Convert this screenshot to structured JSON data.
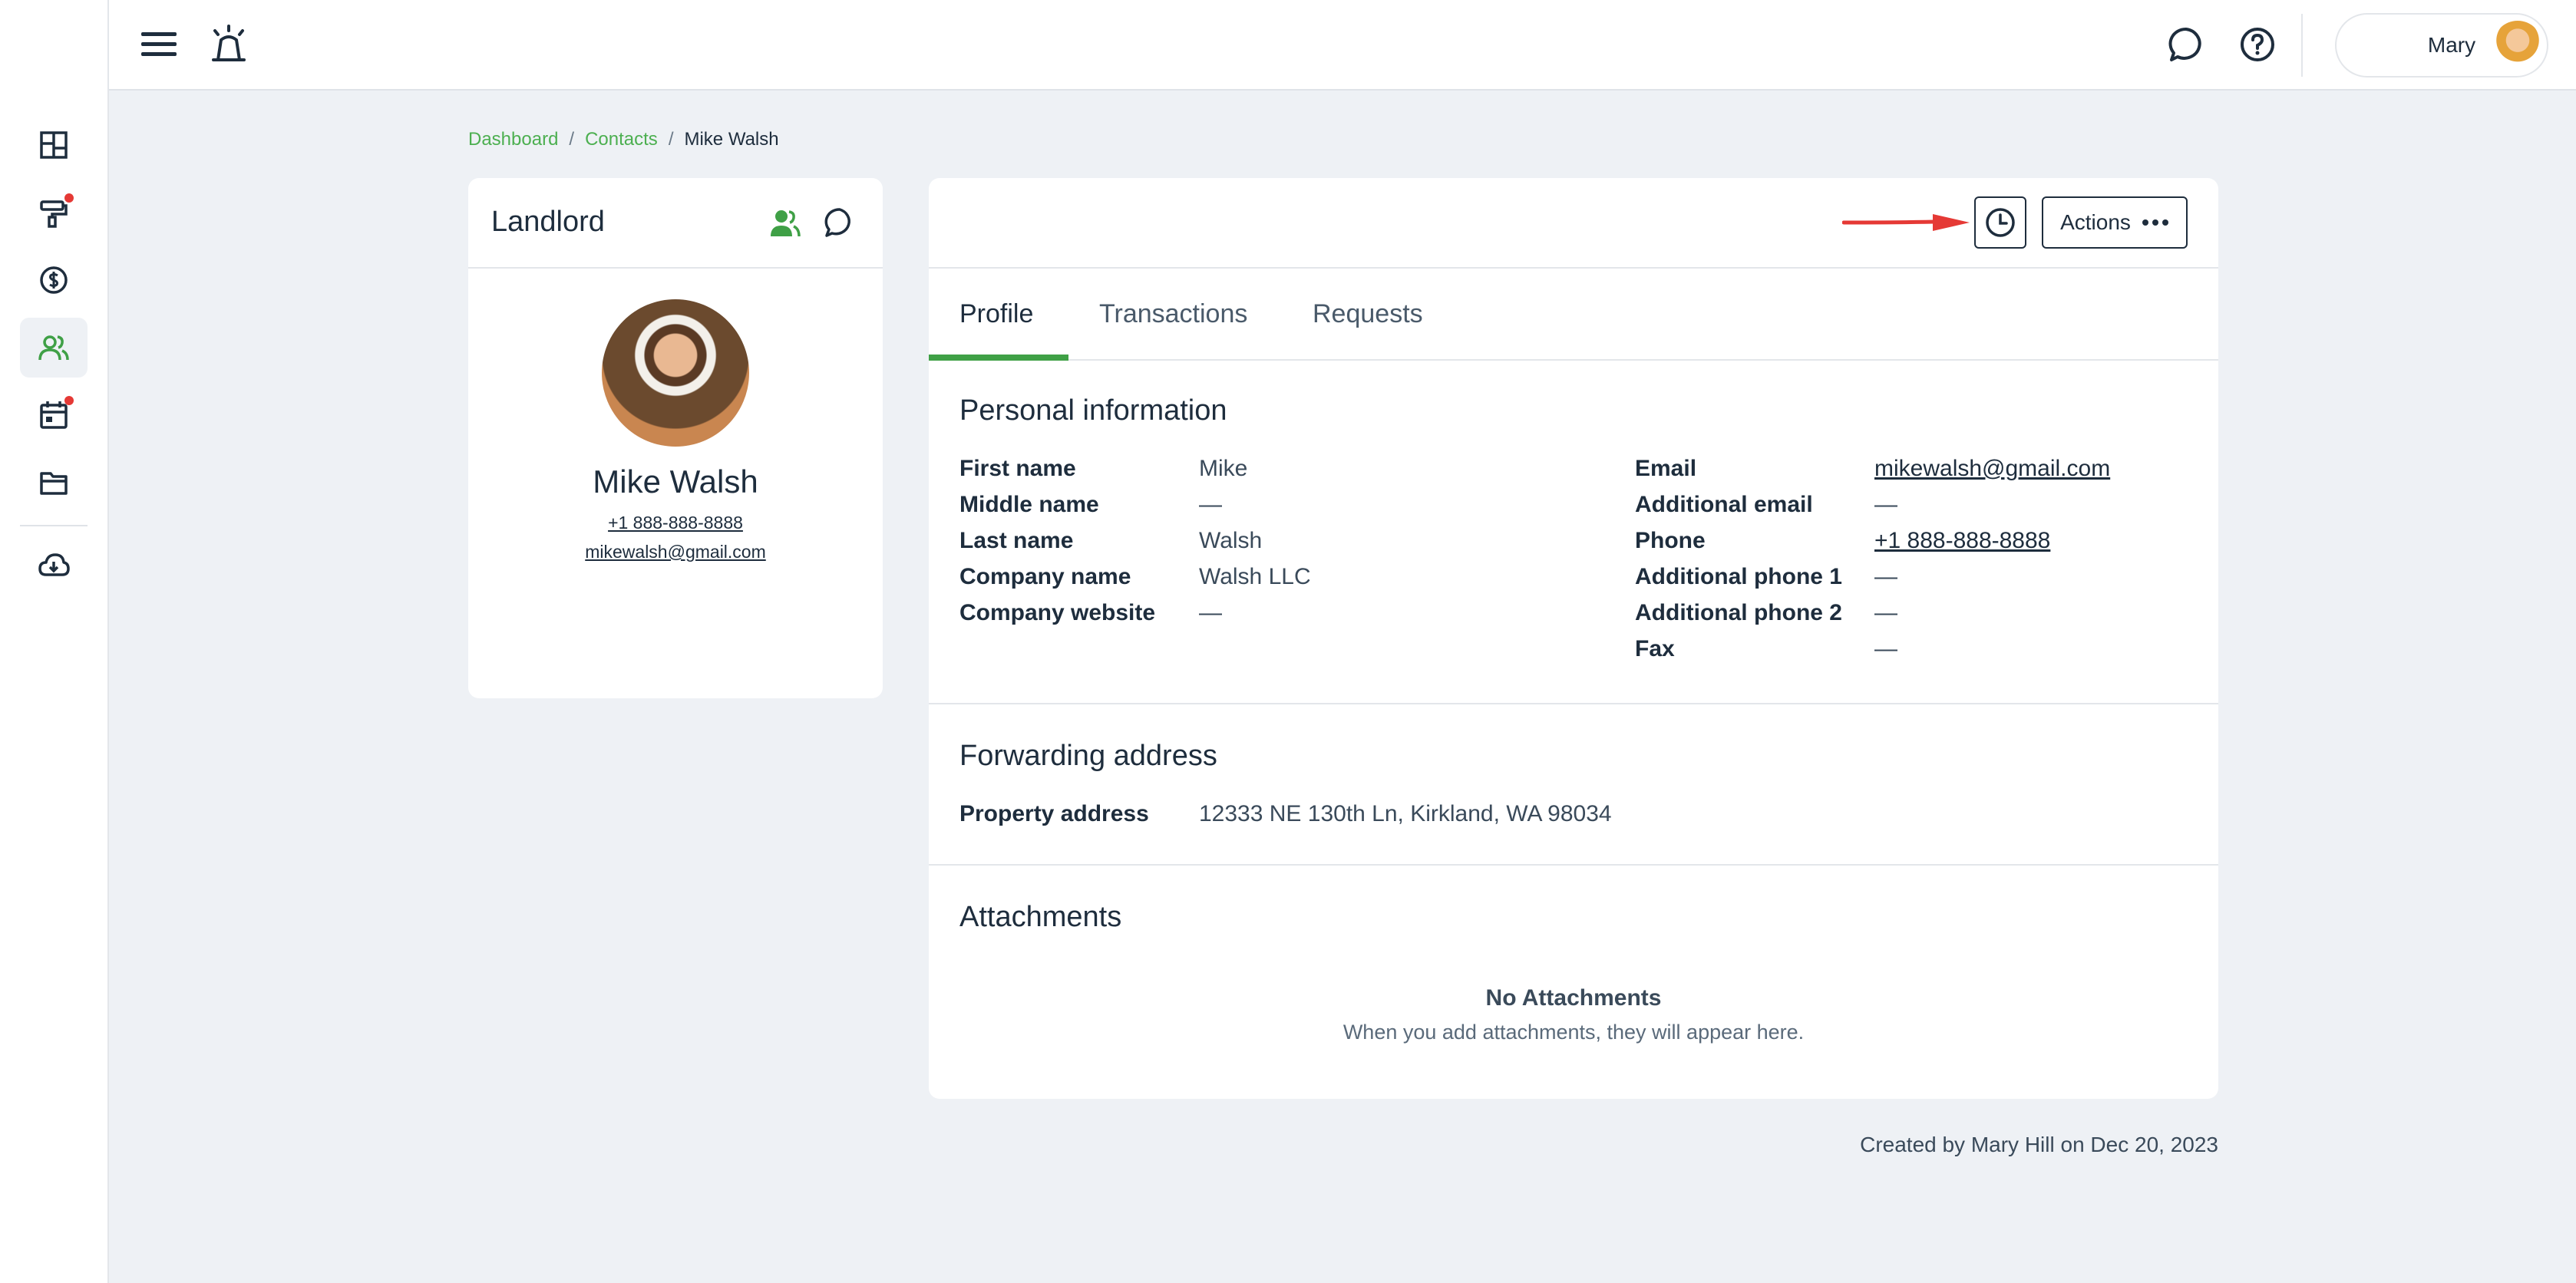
{
  "header": {
    "menu_icon": "hamburger-icon",
    "alarm_icon": "alarm-icon",
    "chat_icon": "chat-icon",
    "help_icon": "help-icon",
    "user_name": "Mary"
  },
  "sidebar": {
    "items": [
      {
        "icon": "dashboard-icon"
      },
      {
        "icon": "maintenance-icon",
        "badge": true
      },
      {
        "icon": "dollar-icon"
      },
      {
        "icon": "contacts-icon",
        "active": true
      },
      {
        "icon": "calendar-icon",
        "badge": true
      },
      {
        "icon": "folder-icon"
      },
      {
        "icon": "cloud-download-icon"
      }
    ]
  },
  "breadcrumb": {
    "items": [
      "Dashboard",
      "Contacts",
      "Mike Walsh"
    ],
    "separator": "/"
  },
  "contact_card": {
    "role": "Landlord",
    "name": "Mike Walsh",
    "phone": "+1 888-888-8888",
    "email": "mikewalsh@gmail.com"
  },
  "toolbar": {
    "actions_label": "Actions",
    "history_icon": "clock-icon"
  },
  "tabs": [
    {
      "label": "Profile",
      "active": true
    },
    {
      "label": "Transactions",
      "active": false
    },
    {
      "label": "Requests",
      "active": false
    }
  ],
  "personal_info": {
    "title": "Personal information",
    "left": [
      {
        "label": "First name",
        "value": "Mike"
      },
      {
        "label": "Middle name",
        "value": "—"
      },
      {
        "label": "Last name",
        "value": "Walsh"
      },
      {
        "label": "Company name",
        "value": "Walsh LLC"
      },
      {
        "label": "Company website",
        "value": "—"
      }
    ],
    "right": [
      {
        "label": "Email",
        "value": "mikewalsh@gmail.com"
      },
      {
        "label": "Additional email",
        "value": "—"
      },
      {
        "label": "Phone",
        "value": "+1 888-888-8888"
      },
      {
        "label": "Additional phone 1",
        "value": "—"
      },
      {
        "label": "Additional phone 2",
        "value": "—"
      },
      {
        "label": "Fax",
        "value": "—"
      }
    ]
  },
  "forwarding": {
    "title": "Forwarding address",
    "label": "Property address",
    "value": "12333 NE 130th Ln, Kirkland, WA 98034"
  },
  "attachments": {
    "title": "Attachments",
    "empty_title": "No Attachments",
    "empty_sub": "When you add attachments, they will appear here."
  },
  "footer": {
    "created": "Created by Mary Hill on Dec 20, 2023"
  },
  "colors": {
    "accent": "#3fa046",
    "text": "#1e2d3d",
    "badge": "#e53935",
    "arrow": "#e53935"
  }
}
